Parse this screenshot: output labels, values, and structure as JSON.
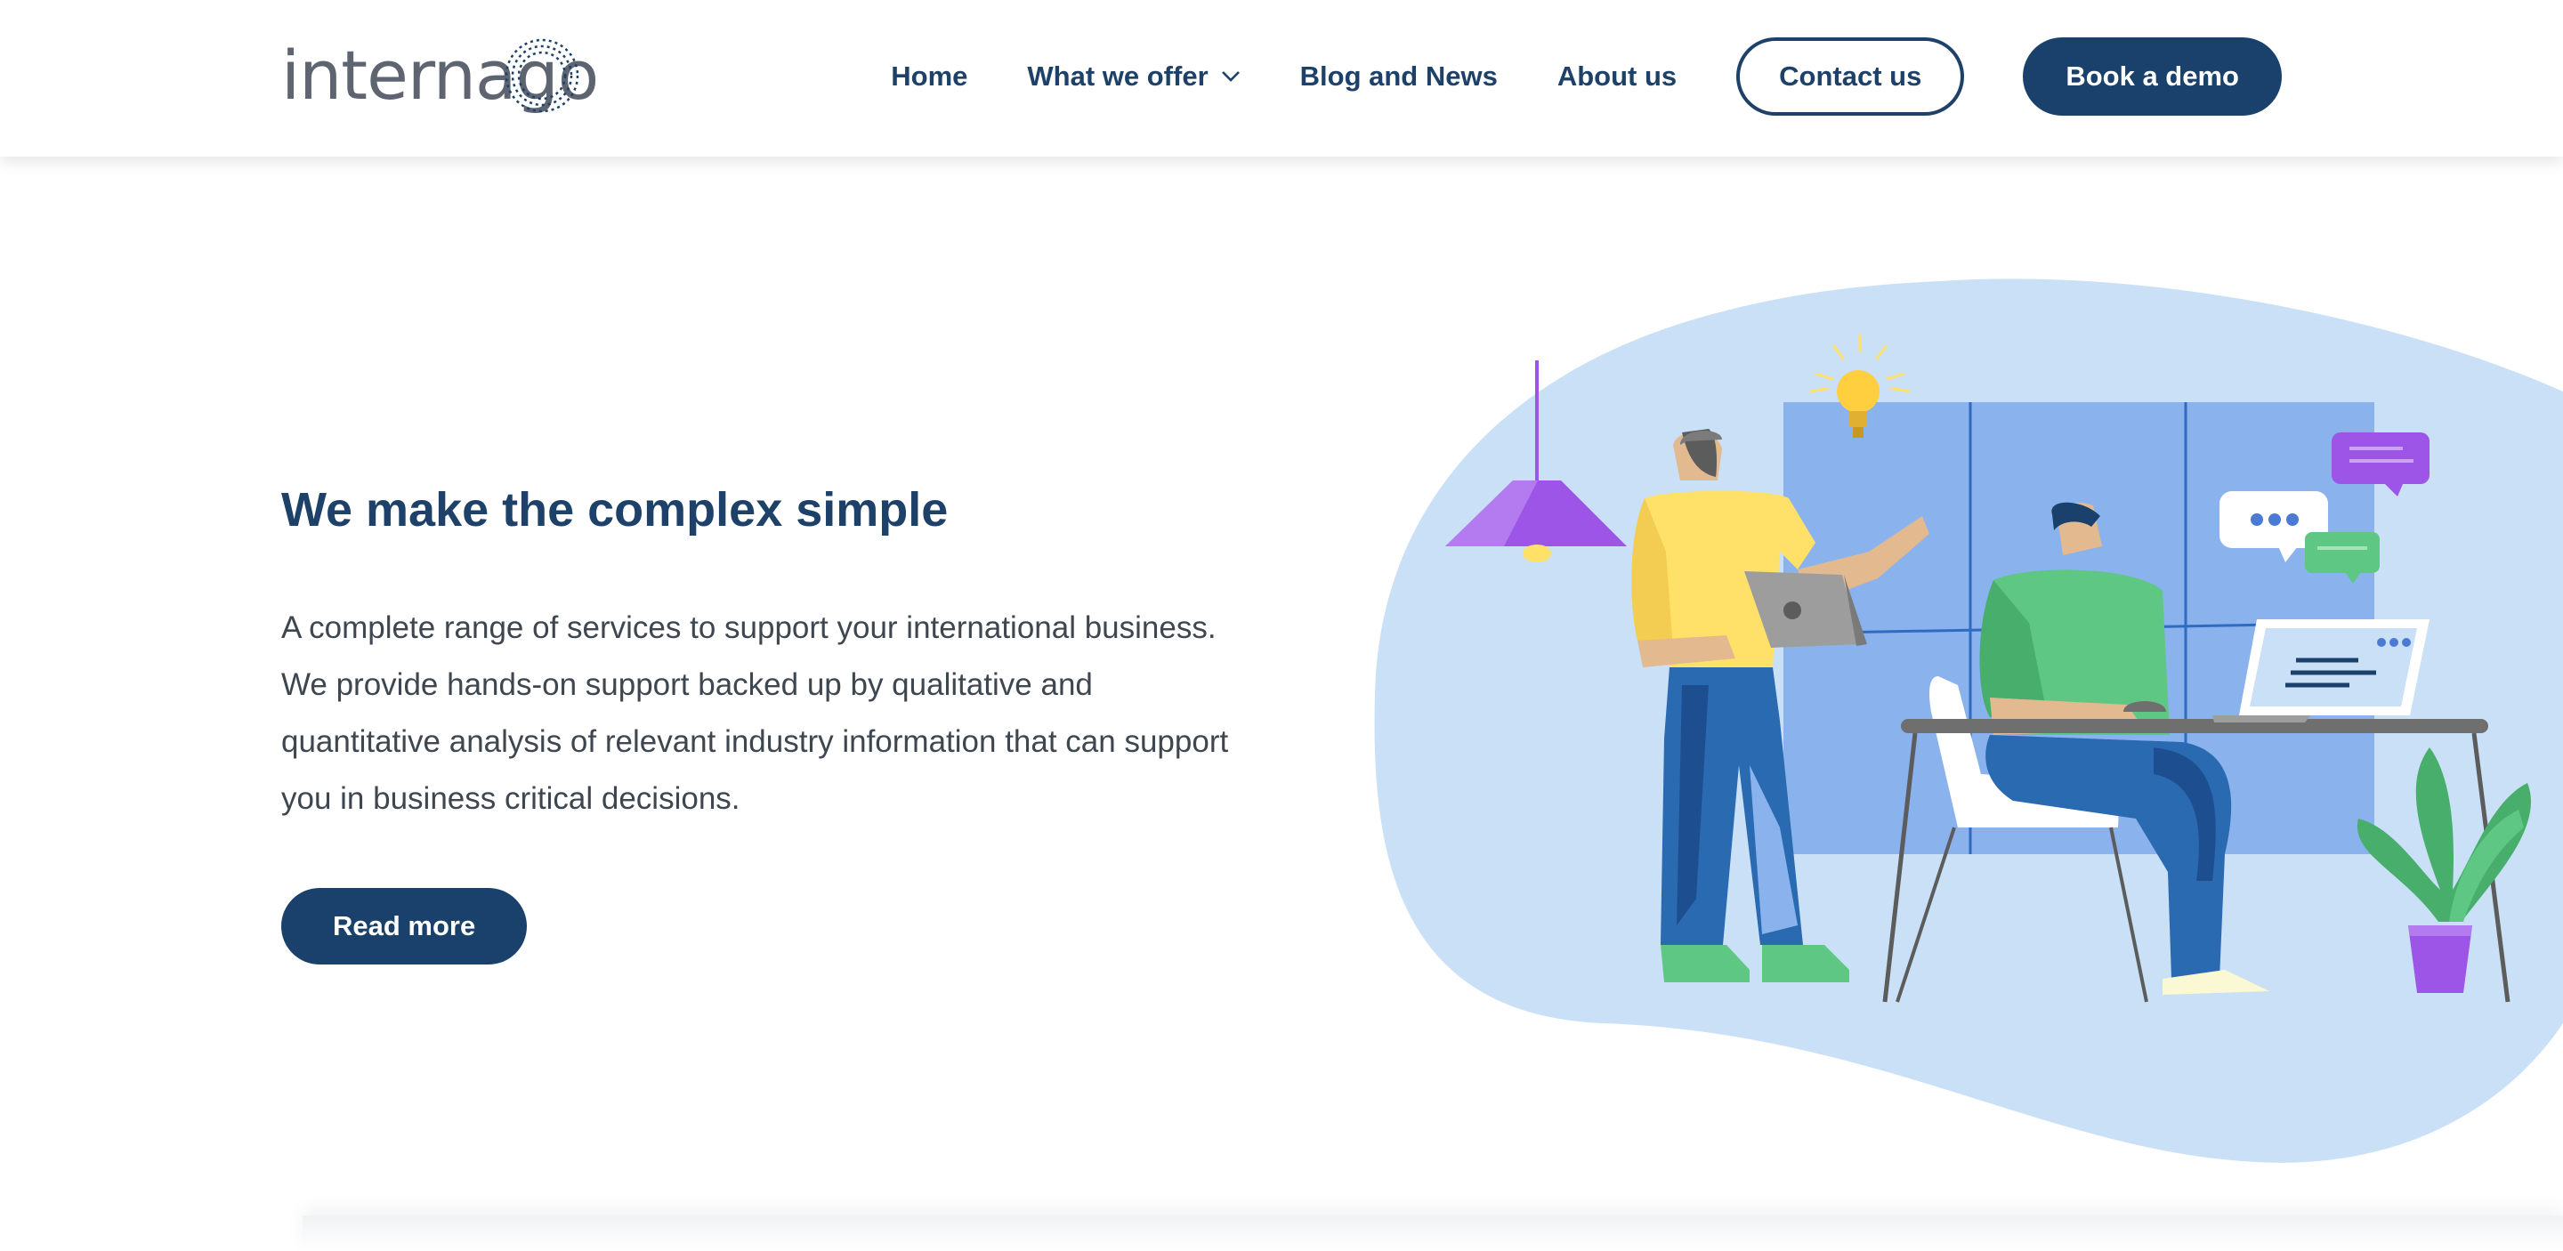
{
  "brand": {
    "logo_text": "internago"
  },
  "nav": {
    "items": [
      {
        "label": "Home"
      },
      {
        "label": "What we offer",
        "has_dropdown": true
      },
      {
        "label": "Blog and News"
      },
      {
        "label": "About us"
      }
    ],
    "contact_label": "Contact us",
    "demo_label": "Book a demo"
  },
  "hero": {
    "title": "We make the complex simple",
    "description": "A complete range of services to support your international business. We provide hands-on support backed up by qualitative and quantitative analysis of relevant industry information that can support you in business critical decisions.",
    "cta_label": "Read more"
  },
  "colors": {
    "brand_navy": "#1a416b",
    "blob_light_blue": "#c9e0f7",
    "window_blue": "#8ab2ec",
    "accent_purple": "#9c55e6",
    "accent_green": "#5ec783",
    "accent_yellow": "#ffe16a"
  },
  "icons": [
    "chevron-down-icon",
    "lightbulb-icon",
    "chat-bubble-icon"
  ]
}
